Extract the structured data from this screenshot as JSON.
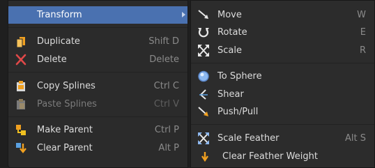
{
  "left_menu": {
    "items": [
      {
        "label": "Transform",
        "shortcut": "",
        "icon": "none"
      },
      {
        "label": "Duplicate",
        "shortcut": "Shift D",
        "icon": "duplicate-icon"
      },
      {
        "label": "Delete",
        "shortcut": "Delete",
        "icon": "delete-x-icon"
      },
      {
        "label": "Copy Splines",
        "shortcut": "Ctrl C",
        "icon": "copy-icon"
      },
      {
        "label": "Paste Splines",
        "shortcut": "Ctrl V",
        "icon": "paste-icon"
      },
      {
        "label": "Make Parent",
        "shortcut": "Ctrl P",
        "icon": "make-parent-icon"
      },
      {
        "label": "Clear Parent",
        "shortcut": "Alt P",
        "icon": "clear-parent-icon"
      }
    ]
  },
  "right_menu": {
    "items": [
      {
        "label": "Move",
        "shortcut": "W",
        "icon": "move-icon"
      },
      {
        "label": "Rotate",
        "shortcut": "E",
        "icon": "rotate-icon"
      },
      {
        "label": "Scale",
        "shortcut": "R",
        "icon": "scale-icon"
      },
      {
        "label": "To Sphere",
        "shortcut": "",
        "icon": "to-sphere-icon"
      },
      {
        "label": "Shear",
        "shortcut": "",
        "icon": "shear-icon"
      },
      {
        "label": "Push/Pull",
        "shortcut": "",
        "icon": "push-pull-icon"
      },
      {
        "label": "Scale Feather",
        "shortcut": "Alt S",
        "icon": "scale-feather-icon"
      },
      {
        "label": "Clear Feather Weight",
        "shortcut": "",
        "icon": "clear-feather-weight-icon"
      }
    ]
  },
  "colors": {
    "highlight": "#4a71b0",
    "menu_bg": "#2b2b2b",
    "delete_red": "#e04848",
    "accent_orange": "#f0a020"
  }
}
